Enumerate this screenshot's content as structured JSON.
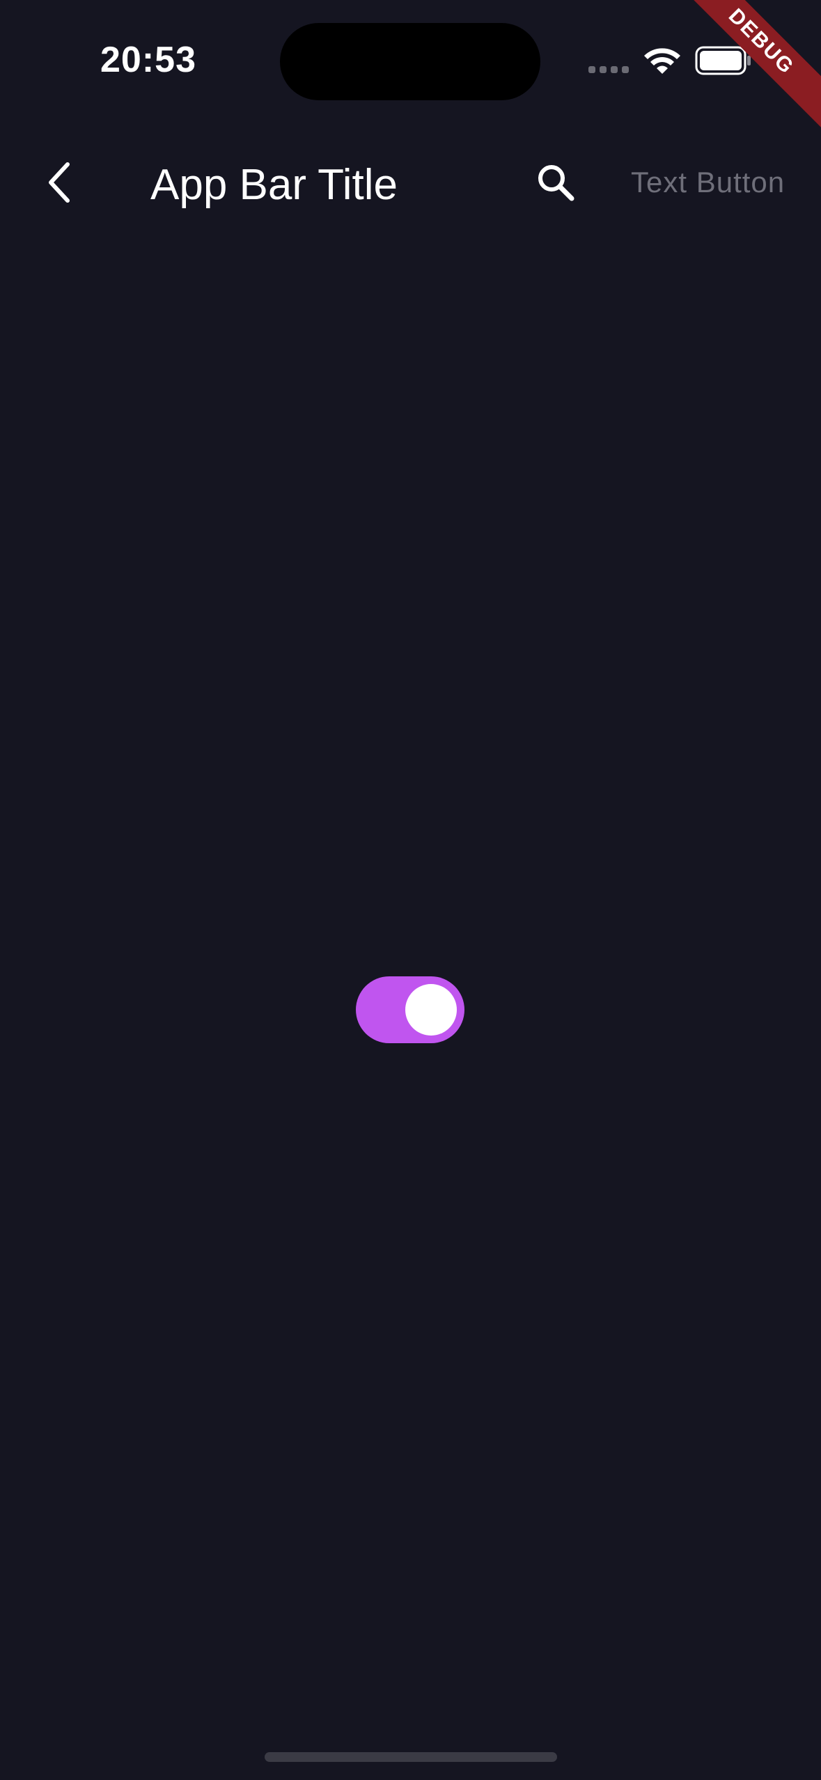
{
  "status_bar": {
    "time": "20:53",
    "signal_icon": "cellular-signal-icon",
    "wifi_icon": "wifi-icon",
    "battery_icon": "battery-icon"
  },
  "debug_banner": {
    "label": "DEBUG",
    "color": "#8b1d22"
  },
  "app_bar": {
    "back_icon": "chevron-left-icon",
    "title": "App Bar Title",
    "search_icon": "search-icon",
    "text_button_label": "Text Button"
  },
  "main": {
    "toggle": {
      "state": "on",
      "track_color": "#c055ef",
      "thumb_color": "#ffffff"
    }
  },
  "colors": {
    "background": "#151521",
    "text_primary": "#ffffff",
    "text_button": "#6f6f7a"
  }
}
